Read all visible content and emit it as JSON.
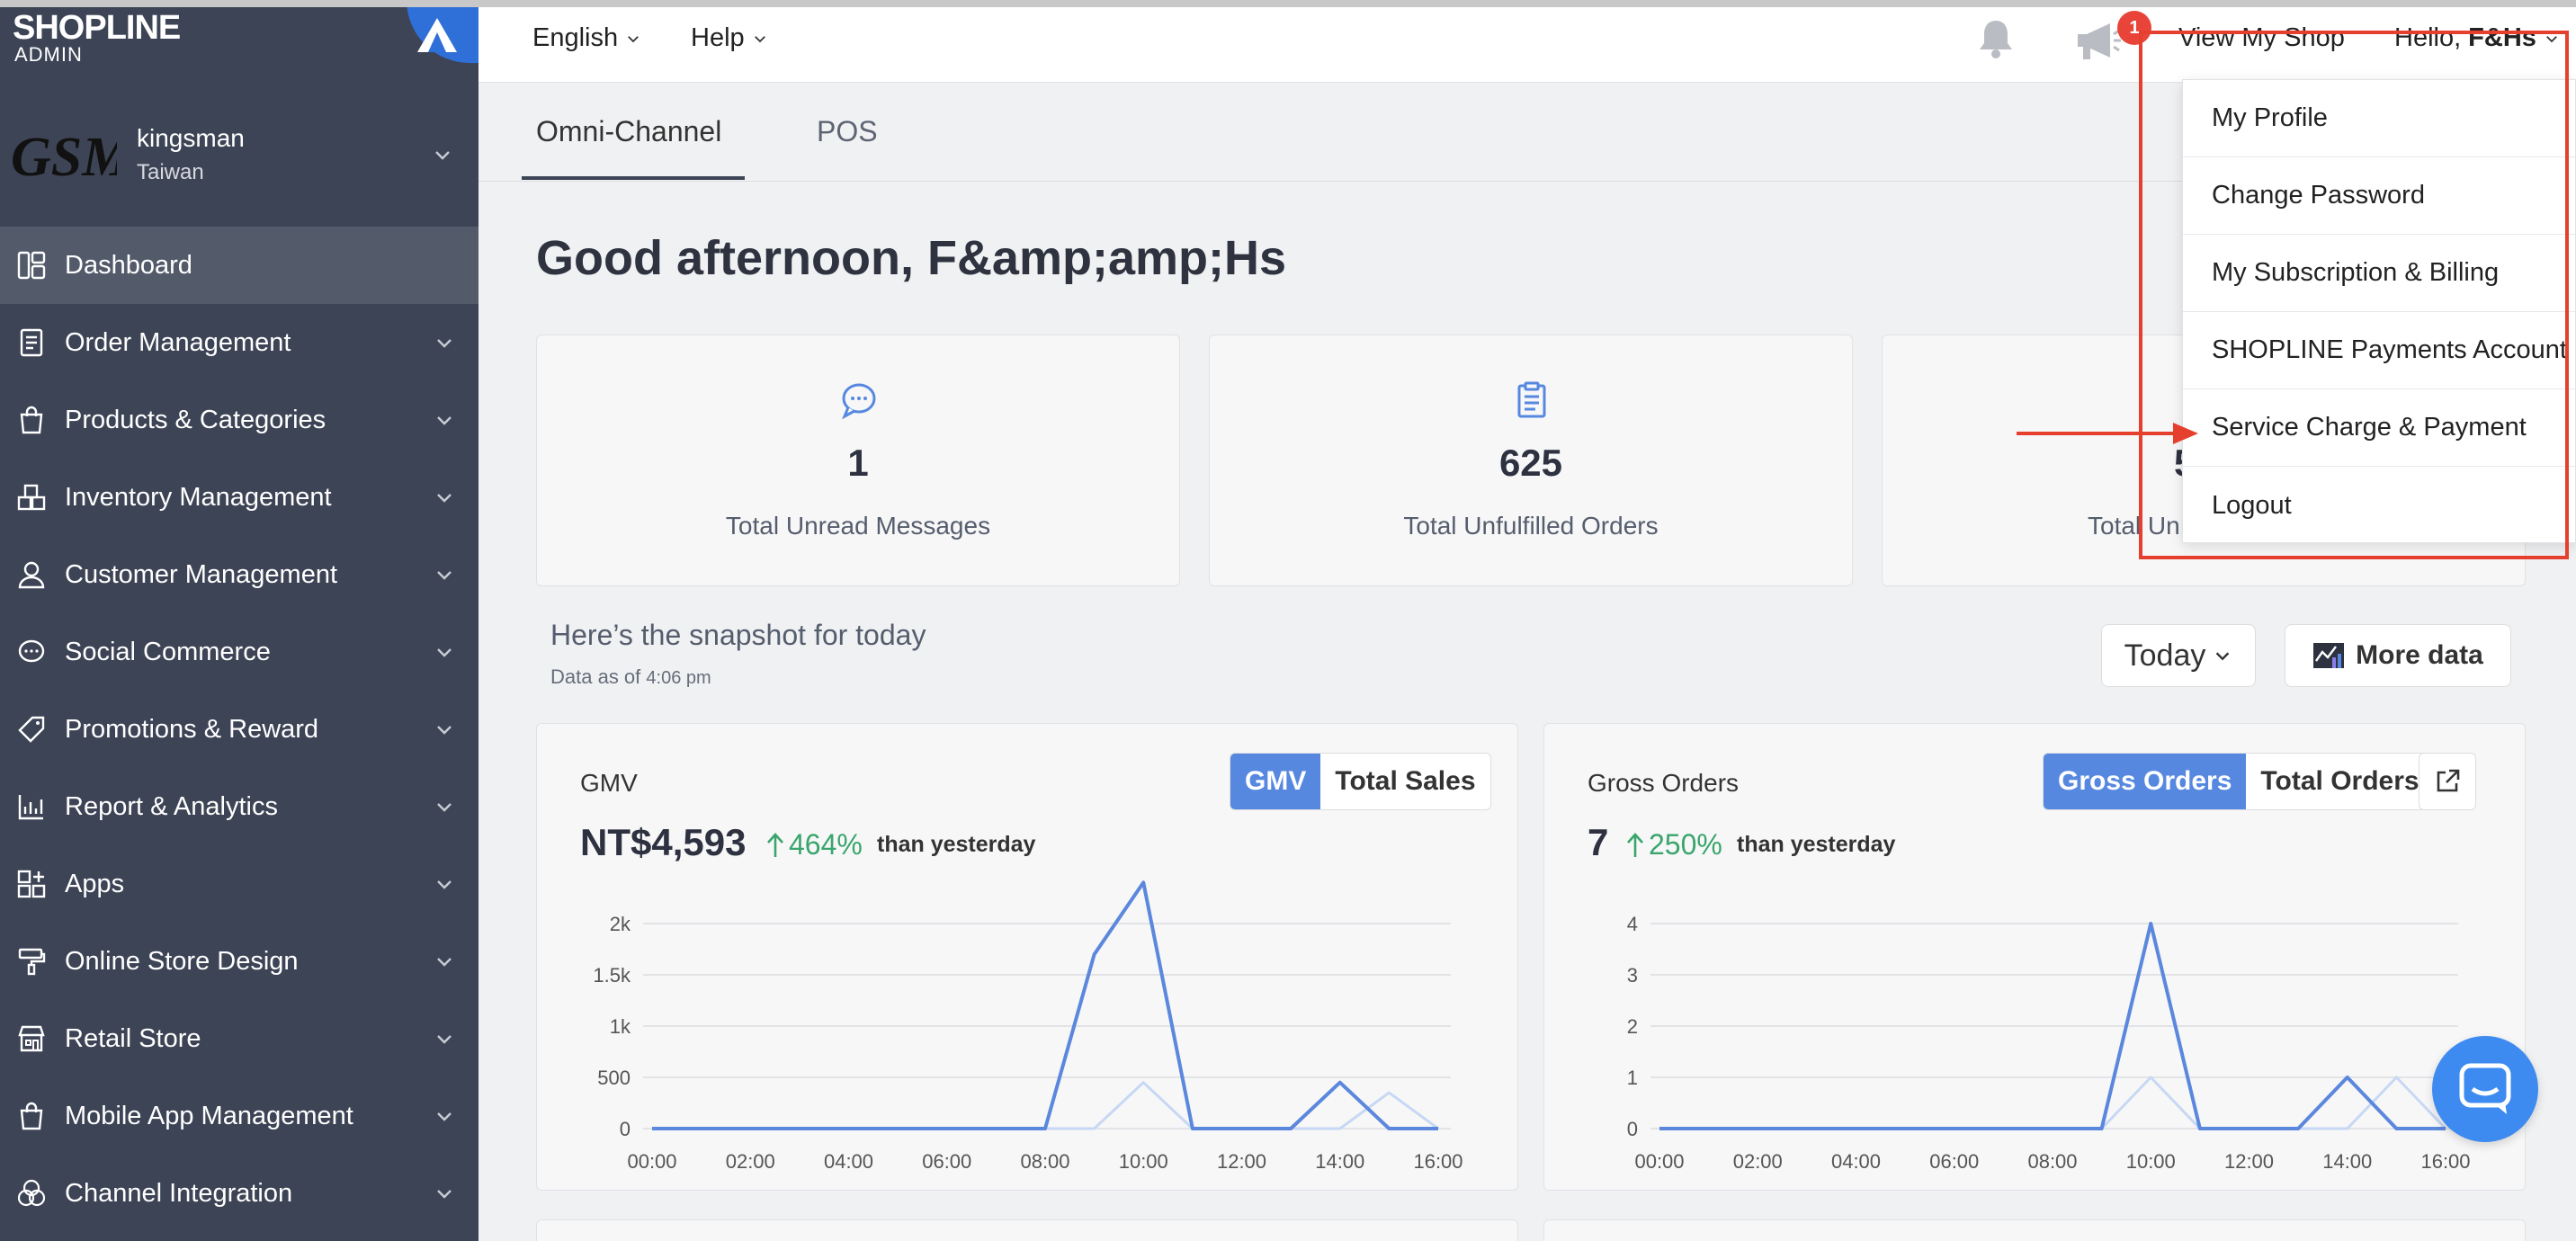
{
  "brand": {
    "logo": "SHOPLINE",
    "logo_sub": "ADMIN"
  },
  "shop": {
    "logo_text": "GSM",
    "name": "kingsman",
    "region": "Taiwan"
  },
  "sidebar": {
    "items": [
      {
        "label": "Dashboard",
        "icon": "dashboard-icon",
        "active": true
      },
      {
        "label": "Order Management",
        "icon": "order-icon"
      },
      {
        "label": "Products & Categories",
        "icon": "bag-icon"
      },
      {
        "label": "Inventory Management",
        "icon": "inventory-icon"
      },
      {
        "label": "Customer Management",
        "icon": "person-icon"
      },
      {
        "label": "Social Commerce",
        "icon": "chat-icon"
      },
      {
        "label": "Promotions & Reward",
        "icon": "tag-icon"
      },
      {
        "label": "Report & Analytics",
        "icon": "report-icon"
      },
      {
        "label": "Apps",
        "icon": "apps-icon"
      },
      {
        "label": "Online Store Design",
        "icon": "brush-icon"
      },
      {
        "label": "Retail Store",
        "icon": "store-icon"
      },
      {
        "label": "Mobile App Management",
        "icon": "mobile-bag-icon"
      },
      {
        "label": "Channel Integration",
        "icon": "channel-icon"
      }
    ]
  },
  "header": {
    "language": "English",
    "help": "Help",
    "notification_count": "1",
    "view_shop": "View My Shop",
    "hello": "Hello,",
    "user": "F&Hs"
  },
  "tabs": [
    {
      "label": "Omni-Channel"
    },
    {
      "label": "POS"
    }
  ],
  "greeting": "Good afternoon, F&amp;amp;Hs",
  "stats": [
    {
      "value": "1",
      "label": "Total Unread Messages",
      "icon": "message-icon"
    },
    {
      "value": "625",
      "label": "Total Unfulfilled Orders",
      "icon": "clipboard-icon"
    },
    {
      "value": "5",
      "label": "Total Un",
      "icon": ""
    }
  ],
  "snapshot": {
    "title": "Here’s the snapshot for today",
    "data_as_of": "Data as of",
    "time": "4:06 pm"
  },
  "controls": {
    "range": "Today",
    "more_data": "More data"
  },
  "gmv_card": {
    "title": "GMV",
    "value": "NT$4,593",
    "pct": "464%",
    "than": "than yesterday",
    "toggle": [
      "GMV",
      "Total Sales"
    ]
  },
  "orders_card": {
    "title": "Gross Orders",
    "value": "7",
    "pct": "250%",
    "than": "than yesterday",
    "toggle": [
      "Gross Orders",
      "Total Orders"
    ]
  },
  "account_menu": {
    "items": [
      "My Profile",
      "Change Password",
      "My Subscription & Billing",
      "SHOPLINE Payments Account",
      "Service Charge & Payment",
      "Logout"
    ]
  },
  "colors": {
    "sidebar": "#3d4455",
    "accent": "#5788e0",
    "line": "#5b87dd",
    "line_prev": "#c7d8f4",
    "positive": "#3aa56c",
    "highlight": "#e5402e"
  },
  "chart_data": [
    {
      "type": "line",
      "x": [
        "00:00",
        "01:00",
        "02:00",
        "03:00",
        "04:00",
        "05:00",
        "06:00",
        "07:00",
        "08:00",
        "09:00",
        "10:00",
        "11:00",
        "12:00",
        "13:00",
        "14:00",
        "15:00",
        "16:00"
      ],
      "xticks": [
        "00:00",
        "02:00",
        "04:00",
        "06:00",
        "08:00",
        "10:00",
        "12:00",
        "14:00",
        "16:00"
      ],
      "yticks": [
        "0",
        "500",
        "1k",
        "1.5k",
        "2k"
      ],
      "ylim": [
        0,
        2000
      ],
      "series": [
        {
          "values": [
            0,
            0,
            0,
            0,
            0,
            0,
            0,
            0,
            0,
            1700,
            2400,
            0,
            0,
            0,
            450,
            0,
            0
          ]
        },
        {
          "values": [
            0,
            0,
            0,
            0,
            0,
            0,
            0,
            0,
            0,
            0,
            450,
            0,
            0,
            0,
            0,
            350,
            0
          ]
        }
      ]
    },
    {
      "type": "line",
      "x": [
        "00:00",
        "01:00",
        "02:00",
        "03:00",
        "04:00",
        "05:00",
        "06:00",
        "07:00",
        "08:00",
        "09:00",
        "10:00",
        "11:00",
        "12:00",
        "13:00",
        "14:00",
        "15:00",
        "16:00"
      ],
      "xticks": [
        "00:00",
        "02:00",
        "04:00",
        "06:00",
        "08:00",
        "10:00",
        "12:00",
        "14:00",
        "16:00"
      ],
      "yticks": [
        "0",
        "1",
        "2",
        "3",
        "4"
      ],
      "ylim": [
        0,
        4
      ],
      "series": [
        {
          "values": [
            0,
            0,
            0,
            0,
            0,
            0,
            0,
            0,
            0,
            0,
            4,
            0,
            0,
            0,
            1,
            0,
            0
          ]
        },
        {
          "values": [
            0,
            0,
            0,
            0,
            0,
            0,
            0,
            0,
            0,
            0,
            1,
            0,
            0,
            0,
            0,
            1,
            0
          ]
        }
      ]
    }
  ]
}
